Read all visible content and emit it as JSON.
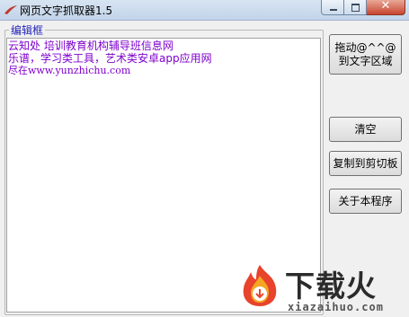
{
  "window": {
    "title": "网页文字抓取器1.5",
    "close_glyph": "✕"
  },
  "editor": {
    "group_label": "编辑框",
    "lines": [
      "云知处 培训教育机构辅导班信息网",
      "乐谱，学习类工具，艺术类安卓app应用网",
      "尽在www.yunzhichu.com"
    ]
  },
  "buttons": {
    "drag": "拖动@^^@到文字区域",
    "clear": "清空",
    "copy": "复制到剪切板",
    "about": "关于本程序"
  },
  "watermark": {
    "name": "下载火",
    "url": "xiazaihuo.com"
  },
  "colors": {
    "text": "#7e00cc",
    "group_label": "#2424b8",
    "watermark_red": "#e8432c",
    "watermark_orange": "#f5a623"
  }
}
